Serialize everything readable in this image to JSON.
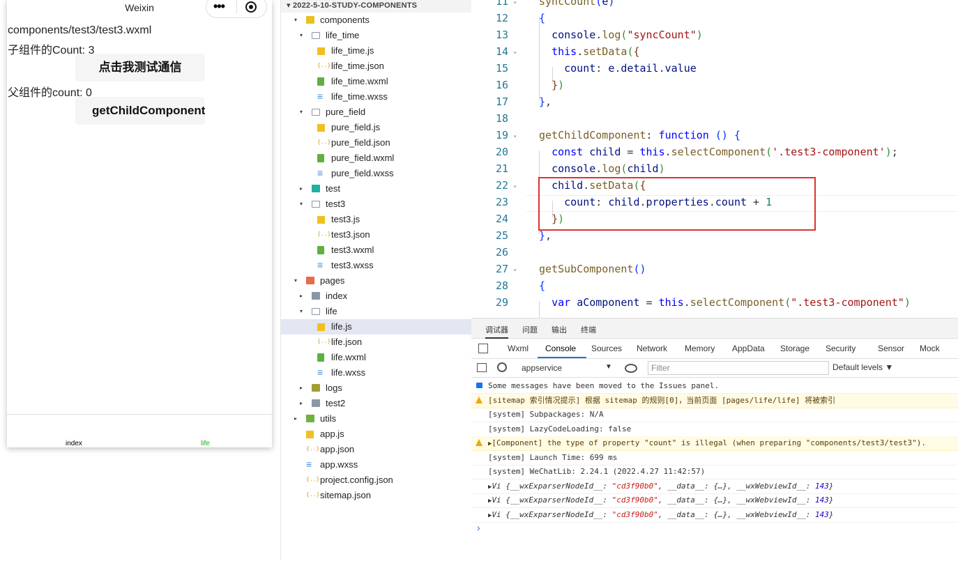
{
  "simulator": {
    "title": "Weixin",
    "capsule_dots": "•••",
    "path": "components/test3/test3.wxml",
    "child_count_label": "子组件的Count: 3",
    "test_button": "点击我测试通信",
    "parent_count_label": "父组件的count: 0",
    "get_child_button": "getChildComponent",
    "tabs": [
      {
        "label": "index",
        "color": "#000000"
      },
      {
        "label": "life",
        "color": "#1aad19"
      }
    ]
  },
  "tree": {
    "header": "2022-5-10-STUDY-COMPONENTS",
    "items": [
      {
        "label": "components",
        "depth": 1,
        "twisty": "▾",
        "icon": "folder-components-icon"
      },
      {
        "label": "life_time",
        "depth": 2,
        "twisty": "▾",
        "icon": "folder-open-icon"
      },
      {
        "label": "life_time.js",
        "depth": 3,
        "twisty": "",
        "icon": "js-file-icon"
      },
      {
        "label": "life_time.json",
        "depth": 3,
        "twisty": "",
        "icon": "json-file-icon"
      },
      {
        "label": "life_time.wxml",
        "depth": 3,
        "twisty": "",
        "icon": "wxml-file-icon"
      },
      {
        "label": "life_time.wxss",
        "depth": 3,
        "twisty": "",
        "icon": "wxss-file-icon"
      },
      {
        "label": "pure_field",
        "depth": 2,
        "twisty": "▾",
        "icon": "folder-open-icon"
      },
      {
        "label": "pure_field.js",
        "depth": 3,
        "twisty": "",
        "icon": "js-file-icon"
      },
      {
        "label": "pure_field.json",
        "depth": 3,
        "twisty": "",
        "icon": "json-file-icon"
      },
      {
        "label": "pure_field.wxml",
        "depth": 3,
        "twisty": "",
        "icon": "wxml-file-icon"
      },
      {
        "label": "pure_field.wxss",
        "depth": 3,
        "twisty": "",
        "icon": "wxss-file-icon"
      },
      {
        "label": "test",
        "depth": 2,
        "twisty": "▸",
        "icon": "folder-test-icon"
      },
      {
        "label": "test3",
        "depth": 2,
        "twisty": "▾",
        "icon": "folder-open-icon"
      },
      {
        "label": "test3.js",
        "depth": 3,
        "twisty": "",
        "icon": "js-file-icon"
      },
      {
        "label": "test3.json",
        "depth": 3,
        "twisty": "",
        "icon": "json-file-icon"
      },
      {
        "label": "test3.wxml",
        "depth": 3,
        "twisty": "",
        "icon": "wxml-file-icon"
      },
      {
        "label": "test3.wxss",
        "depth": 3,
        "twisty": "",
        "icon": "wxss-file-icon"
      },
      {
        "label": "pages",
        "depth": 1,
        "twisty": "▾",
        "icon": "folder-pages-icon"
      },
      {
        "label": "index",
        "depth": 2,
        "twisty": "▸",
        "icon": "folder-icon"
      },
      {
        "label": "life",
        "depth": 2,
        "twisty": "▾",
        "icon": "folder-open-icon"
      },
      {
        "label": "life.js",
        "depth": 3,
        "twisty": "",
        "icon": "js-file-icon",
        "selected": true
      },
      {
        "label": "life.json",
        "depth": 3,
        "twisty": "",
        "icon": "json-file-icon"
      },
      {
        "label": "life.wxml",
        "depth": 3,
        "twisty": "",
        "icon": "wxml-file-icon"
      },
      {
        "label": "life.wxss",
        "depth": 3,
        "twisty": "",
        "icon": "wxss-file-icon"
      },
      {
        "label": "logs",
        "depth": 2,
        "twisty": "▸",
        "icon": "folder-logs-icon"
      },
      {
        "label": "test2",
        "depth": 2,
        "twisty": "▸",
        "icon": "folder-icon"
      },
      {
        "label": "utils",
        "depth": 1,
        "twisty": "▸",
        "icon": "folder-utils-icon"
      },
      {
        "label": "app.js",
        "depth": 1,
        "twisty": "",
        "icon": "js-file-icon"
      },
      {
        "label": "app.json",
        "depth": 1,
        "twisty": "",
        "icon": "json-file-icon"
      },
      {
        "label": "app.wxss",
        "depth": 1,
        "twisty": "",
        "icon": "wxss-file-icon"
      },
      {
        "label": "project.config.json",
        "depth": 1,
        "twisty": "",
        "icon": "json-file-icon"
      },
      {
        "label": "sitemap.json",
        "depth": 1,
        "twisty": "",
        "icon": "json-file-icon"
      }
    ]
  },
  "editor": {
    "lines": [
      {
        "num": "11",
        "fold": "⌄",
        "html": "<span class=\"f\">syncCount</span><span class=\"b1\">(</span><span class=\"v\">e</span><span class=\"b1\">)</span>"
      },
      {
        "num": "12",
        "fold": "",
        "html": "<span class=\"b1\">{</span>"
      },
      {
        "num": "13",
        "fold": "",
        "html": "  <span class=\"v\">console</span>.<span class=\"f\">log</span><span class=\"b2\">(</span><span class=\"s\">\"syncCount\"</span><span class=\"b2\">)</span>"
      },
      {
        "num": "14",
        "fold": "⌄",
        "html": "  <span class=\"k\">this</span>.<span class=\"f\">setData</span><span class=\"b2\">(</span><span class=\"b3\">{</span>"
      },
      {
        "num": "15",
        "fold": "",
        "html": "    <span class=\"v\">count</span>: <span class=\"v\">e</span>.<span class=\"v\">detail</span>.<span class=\"v\">value</span>"
      },
      {
        "num": "16",
        "fold": "",
        "html": "  <span class=\"b3\">}</span><span class=\"b2\">)</span>"
      },
      {
        "num": "17",
        "fold": "",
        "html": "<span class=\"b1\">}</span>,"
      },
      {
        "num": "18",
        "fold": "",
        "html": ""
      },
      {
        "num": "19",
        "fold": "⌄",
        "html": "<span class=\"f\">getChildComponent</span>: <span class=\"k\">function</span> <span class=\"b1\">()</span> <span class=\"b1\">{</span>"
      },
      {
        "num": "20",
        "fold": "",
        "html": "  <span class=\"k\">const</span> <span class=\"v\">child</span> = <span class=\"k\">this</span>.<span class=\"f\">selectComponent</span><span class=\"b2\">(</span><span class=\"s\">'.test3-component'</span><span class=\"b2\">)</span>;"
      },
      {
        "num": "21",
        "fold": "",
        "html": "  <span class=\"v\">console</span>.<span class=\"f\">log</span><span class=\"b2\">(</span><span class=\"v\">child</span><span class=\"b2\">)</span>"
      },
      {
        "num": "22",
        "fold": "⌄",
        "html": "  <span class=\"v\">child</span>.<span class=\"f\">setData</span><span class=\"b2\">(</span><span class=\"b3\">{</span>"
      },
      {
        "num": "23",
        "fold": "",
        "html": "    <span class=\"v\">count</span>: <span class=\"v\">child</span>.<span class=\"v\">properties</span>.<span class=\"v\">count</span> + <span class=\"n\">1</span>"
      },
      {
        "num": "24",
        "fold": "",
        "html": "  <span class=\"b3\">}</span><span class=\"b2\">)</span>"
      },
      {
        "num": "25",
        "fold": "",
        "html": "<span class=\"b1\">}</span>,"
      },
      {
        "num": "26",
        "fold": "",
        "html": ""
      },
      {
        "num": "27",
        "fold": "⌄",
        "html": "<span class=\"f\">getSubComponent</span><span class=\"b1\">()</span>"
      },
      {
        "num": "28",
        "fold": "",
        "html": "<span class=\"b1\">{</span>"
      },
      {
        "num": "29",
        "fold": "",
        "html": "  <span class=\"k\">var</span> <span class=\"v\">aComponent</span> = <span class=\"k\">this</span>.<span class=\"f\">selectComponent</span><span class=\"b2\">(</span><span class=\"s\">\".test3-component\"</span><span class=\"b2\">)</span>"
      }
    ]
  },
  "devtools": {
    "top_tabs": [
      "调试器",
      "问题",
      "输出",
      "终端"
    ],
    "panel_tabs": [
      "Wxml",
      "Console",
      "Sources",
      "Network",
      "Memory",
      "AppData",
      "Storage",
      "Security",
      "Sensor",
      "Mock"
    ],
    "active_panel": "Console",
    "context": "appservice",
    "context_arrow": "▼",
    "filter_placeholder": "Filter",
    "levels": "Default levels ▼",
    "console": [
      {
        "kind": "info",
        "html": "Some messages have been moved to the Issues panel."
      },
      {
        "kind": "warn",
        "html": "[sitemap 索引情况提示] 根据 sitemap 的规则[0]，当前页面 [pages/life/life] 将被索引"
      },
      {
        "kind": "log",
        "html": "[system] Subpackages: N/A"
      },
      {
        "kind": "log",
        "html": "[system] LazyCodeLoading: false"
      },
      {
        "kind": "warn",
        "html": "<span class=\"tri\">▶</span>[Component] the type of property \"count\" is illegal (when preparing \"components/test3/test3\")."
      },
      {
        "kind": "log",
        "html": "[system] Launch Time: 699 ms"
      },
      {
        "kind": "log",
        "html": "[system] WeChatLib: 2.24.1 (2022.4.27 11:42:57)"
      },
      {
        "kind": "log",
        "html": "<span class=\"obj\"><span class=\"tri\">▶</span>Vi {__wxExparserNodeId__: <span class=\"os\">\"cd3f90b0\"</span>, __data__: {…}, __wxWebviewId__: <span class=\"on\">143</span>}</span>"
      },
      {
        "kind": "log",
        "html": "<span class=\"obj\"><span class=\"tri\">▶</span>Vi {__wxExparserNodeId__: <span class=\"os\">\"cd3f90b0\"</span>, __data__: {…}, __wxWebviewId__: <span class=\"on\">143</span>}</span>"
      },
      {
        "kind": "log",
        "html": "<span class=\"obj\"><span class=\"tri\">▶</span>Vi {__wxExparserNodeId__: <span class=\"os\">\"cd3f90b0\"</span>, __data__: {…}, __wxWebviewId__: <span class=\"on\">143</span>}</span>"
      }
    ],
    "prompt": "›"
  }
}
